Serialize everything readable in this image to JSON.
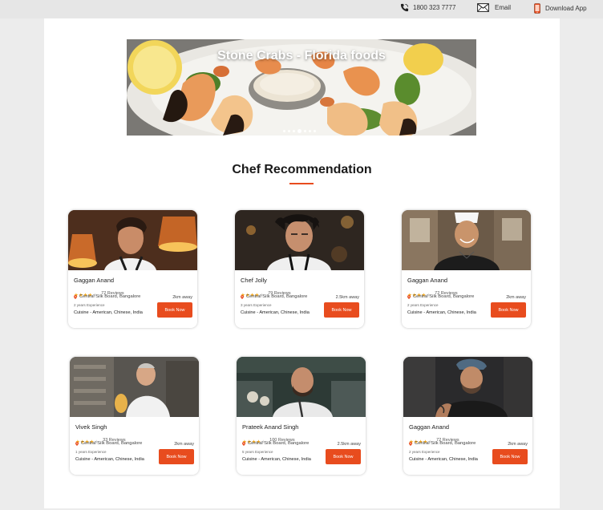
{
  "topbar": {
    "phone": "1800 323 7777",
    "email": "Email",
    "download": "Download App"
  },
  "banner": {
    "title": "Stone Crabs - Florida foods",
    "dots": 7,
    "active_dot": 3
  },
  "section": {
    "title": "Chef Recommendation"
  },
  "colors": {
    "accent": "#e84c1e",
    "star": "#f3a81c"
  },
  "chefs": [
    {
      "name": "Gaggan Anand",
      "rating": 4,
      "reviews": "72 Reviews",
      "location": "Central Silk Board, Bangalore",
      "distance": "2km away",
      "experience": "2 years Experience",
      "cuisine": "Cuisine - American, Chinese, India",
      "button": "Book Now"
    },
    {
      "name": "Chef Jolly",
      "rating": 4,
      "reviews": "79 Reviews",
      "location": "Central Silk Board, Bangalore",
      "distance": "2.5km away",
      "experience": "3 years Experience",
      "cuisine": "Cuisine - American, Chinese, India",
      "button": "Book Now"
    },
    {
      "name": "Gaggan Anand",
      "rating": 4,
      "reviews": "72 Reviews",
      "location": "Central Silk Board, Bangalore",
      "distance": "2km away",
      "experience": "2 years Experience",
      "cuisine": "Cuisine - American, Chinese, India",
      "button": "Book Now"
    },
    {
      "name": "Vivek Singh",
      "rating": 4,
      "reviews": "33 Reviews",
      "location": "Central Silk Board, Bangalore",
      "distance": "2km away",
      "experience": "1 years Experience",
      "cuisine": "Cuisine - American, Chinese, India",
      "button": "Book Now"
    },
    {
      "name": "Prateek Anand Singh",
      "rating": 4,
      "reviews": "100 Reviews",
      "location": "Central Silk Board, Bangalore",
      "distance": "2.5km away",
      "experience": "5 years Experience",
      "cuisine": "Cuisine - American, Chinese, India",
      "button": "Book Now"
    },
    {
      "name": "Gaggan Anand",
      "rating": 4,
      "reviews": "72 Reviews",
      "location": "Central Silk Board, Bangalore",
      "distance": "2km away",
      "experience": "2 years Experience",
      "cuisine": "Cuisine - American, Chinese, India",
      "button": "Book Now"
    }
  ]
}
